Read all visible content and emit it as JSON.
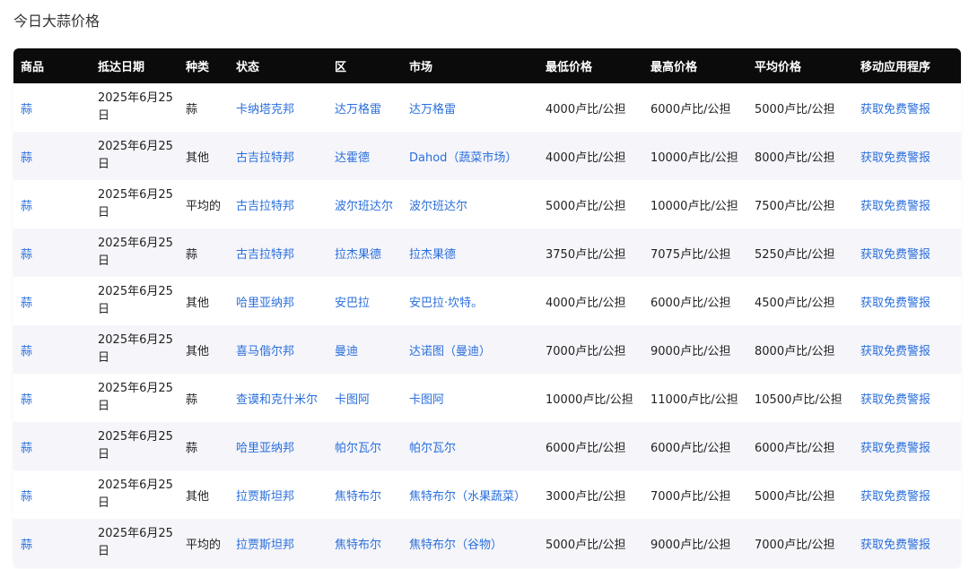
{
  "page_title": "今日大蒜价格",
  "table": {
    "headers": [
      "商品",
      "抵达日期",
      "种类",
      "状态",
      "区",
      "市场",
      "最低价格",
      "最高价格",
      "平均价格",
      "移动应用程序"
    ],
    "rows": [
      {
        "commodity": "蒜",
        "date": "2025年6月25日",
        "variety": "蒜",
        "state": "卡纳塔克邦",
        "district": "达万格雷",
        "market": "达万格雷",
        "min": "4000卢比/公担",
        "max": "6000卢比/公担",
        "avg": "5000卢比/公担",
        "app": "获取免费警报"
      },
      {
        "commodity": "蒜",
        "date": "2025年6月25日",
        "variety": "其他",
        "state": "古吉拉特邦",
        "district": "达霍德",
        "market": "Dahod（蔬菜市场）",
        "min": "4000卢比/公担",
        "max": "10000卢比/公担",
        "avg": "8000卢比/公担",
        "app": "获取免费警报"
      },
      {
        "commodity": "蒜",
        "date": "2025年6月25日",
        "variety": "平均的",
        "state": "古吉拉特邦",
        "district": "波尔班达尔",
        "market": "波尔班达尔",
        "min": "5000卢比/公担",
        "max": "10000卢比/公担",
        "avg": "7500卢比/公担",
        "app": "获取免费警报"
      },
      {
        "commodity": "蒜",
        "date": "2025年6月25日",
        "variety": "蒜",
        "state": "古吉拉特邦",
        "district": "拉杰果德",
        "market": "拉杰果德",
        "min": "3750卢比/公担",
        "max": "7075卢比/公担",
        "avg": "5250卢比/公担",
        "app": "获取免费警报"
      },
      {
        "commodity": "蒜",
        "date": "2025年6月25日",
        "variety": "其他",
        "state": "哈里亚纳邦",
        "district": "安巴拉",
        "market": "安巴拉·坎特。",
        "min": "4000卢比/公担",
        "max": "6000卢比/公担",
        "avg": "4500卢比/公担",
        "app": "获取免费警报"
      },
      {
        "commodity": "蒜",
        "date": "2025年6月25日",
        "variety": "其他",
        "state": "喜马偕尔邦",
        "district": "曼迪",
        "market": "达诺图（曼迪）",
        "min": "7000卢比/公担",
        "max": "9000卢比/公担",
        "avg": "8000卢比/公担",
        "app": "获取免费警报"
      },
      {
        "commodity": "蒜",
        "date": "2025年6月25日",
        "variety": "蒜",
        "state": "查谟和克什米尔",
        "district": "卡图阿",
        "market": "卡图阿",
        "min": "10000卢比/公担",
        "max": "11000卢比/公担",
        "avg": "10500卢比/公担",
        "app": "获取免费警报"
      },
      {
        "commodity": "蒜",
        "date": "2025年6月25日",
        "variety": "蒜",
        "state": "哈里亚纳邦",
        "district": "帕尔瓦尔",
        "market": "帕尔瓦尔",
        "min": "6000卢比/公担",
        "max": "6000卢比/公担",
        "avg": "6000卢比/公担",
        "app": "获取免费警报"
      },
      {
        "commodity": "蒜",
        "date": "2025年6月25日",
        "variety": "其他",
        "state": "拉贾斯坦邦",
        "district": "焦特布尔",
        "market": "焦特布尔（水果蔬菜）",
        "min": "3000卢比/公担",
        "max": "7000卢比/公担",
        "avg": "5000卢比/公担",
        "app": "获取免费警报"
      },
      {
        "commodity": "蒜",
        "date": "2025年6月25日",
        "variety": "平均的",
        "state": "拉贾斯坦邦",
        "district": "焦特布尔",
        "market": "焦特布尔（谷物）",
        "min": "5000卢比/公担",
        "max": "9000卢比/公担",
        "avg": "7000卢比/公担",
        "app": "获取免费警报"
      }
    ]
  },
  "colors": {
    "header_bg": "#0b0b0b",
    "link": "#2a6fdb",
    "row_alt": "#f5f5fa"
  }
}
